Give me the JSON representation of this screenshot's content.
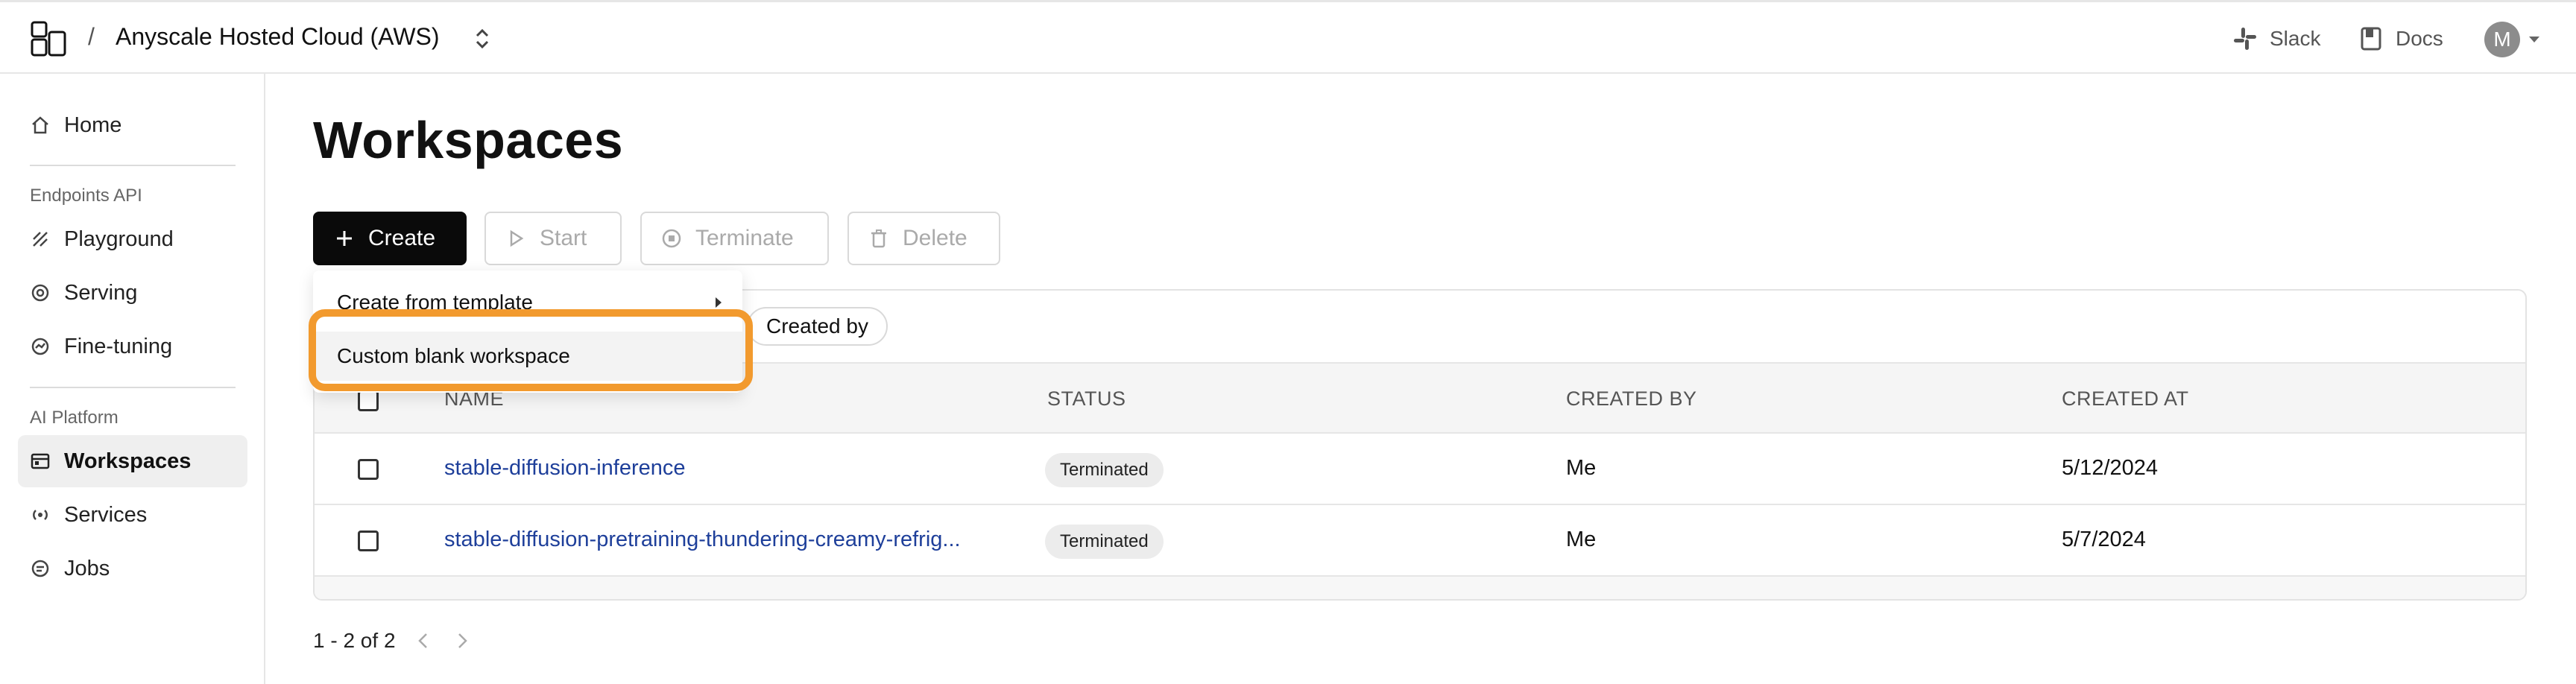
{
  "header": {
    "separator": "/",
    "cloud_name": "Anyscale Hosted Cloud (AWS)",
    "slack_label": "Slack",
    "docs_label": "Docs",
    "avatar_initial": "M"
  },
  "sidebar": {
    "home": "Home",
    "section_endpoints": "Endpoints API",
    "playground": "Playground",
    "serving": "Serving",
    "fine_tuning": "Fine-tuning",
    "section_platform": "AI Platform",
    "workspaces": "Workspaces",
    "services": "Services",
    "jobs": "Jobs",
    "active_item": "Workspaces"
  },
  "main": {
    "title": "Workspaces",
    "toolbar": {
      "create": "Create",
      "start": "Start",
      "terminate": "Terminate",
      "delete": "Delete"
    },
    "filter_created_by": "Created by",
    "table": {
      "columns": [
        "NAME",
        "STATUS",
        "CREATED BY",
        "CREATED AT"
      ],
      "rows": [
        {
          "name": "stable-diffusion-inference",
          "status": "Terminated",
          "created_by": "Me",
          "created_at": "5/12/2024"
        },
        {
          "name": "stable-diffusion-pretraining-thundering-creamy-refrig...",
          "status": "Terminated",
          "created_by": "Me",
          "created_at": "5/7/2024"
        }
      ]
    },
    "pagination": "1 - 2 of 2"
  },
  "create_menu": {
    "from_template": "Create from template",
    "custom_blank": "Custom blank workspace"
  },
  "colors": {
    "accent": "#f29a2e",
    "link": "#1e3f9a",
    "primary_button": "#0a0a0a"
  }
}
